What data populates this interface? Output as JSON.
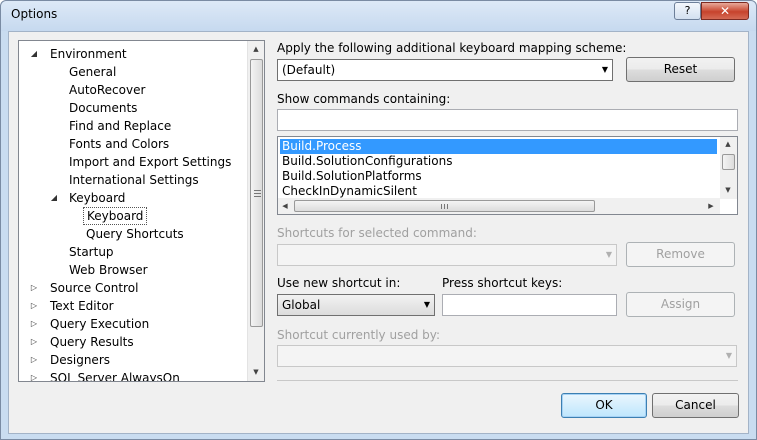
{
  "window": {
    "title": "Options",
    "help_label": "?",
    "close_label": "✕"
  },
  "tree": {
    "items": [
      {
        "label": "Environment",
        "expander": "expanded"
      },
      {
        "label": "General",
        "expander": "none"
      },
      {
        "label": "AutoRecover",
        "expander": "none"
      },
      {
        "label": "Documents",
        "expander": "none"
      },
      {
        "label": "Find and Replace",
        "expander": "none"
      },
      {
        "label": "Fonts and Colors",
        "expander": "none"
      },
      {
        "label": "Import and Export Settings",
        "expander": "none"
      },
      {
        "label": "International Settings",
        "expander": "none"
      },
      {
        "label": "Keyboard",
        "expander": "expanded"
      },
      {
        "label": "Keyboard",
        "expander": "none",
        "selected": true
      },
      {
        "label": "Query Shortcuts",
        "expander": "none"
      },
      {
        "label": "Startup",
        "expander": "none"
      },
      {
        "label": "Web Browser",
        "expander": "none"
      },
      {
        "label": "Source Control",
        "expander": "collapsed"
      },
      {
        "label": "Text Editor",
        "expander": "collapsed"
      },
      {
        "label": "Query Execution",
        "expander": "collapsed"
      },
      {
        "label": "Query Results",
        "expander": "collapsed"
      },
      {
        "label": "Designers",
        "expander": "collapsed"
      },
      {
        "label": "SQL Server AlwaysOn",
        "expander": "collapsed"
      }
    ]
  },
  "mapping": {
    "label": "Apply the following additional keyboard mapping scheme:",
    "value": "(Default)",
    "reset_label": "Reset"
  },
  "commands": {
    "label": "Show commands containing:",
    "search_value": "",
    "items": [
      "Build.Process",
      "Build.SolutionConfigurations",
      "Build.SolutionPlatforms",
      "CheckInDynamicSilent"
    ],
    "selected_index": 0
  },
  "shortcuts": {
    "label": "Shortcuts for selected command:",
    "value": "",
    "remove_label": "Remove"
  },
  "new_shortcut": {
    "use_in_label": "Use new shortcut in:",
    "use_in_value": "Global",
    "press_keys_label": "Press shortcut keys:",
    "press_keys_value": "",
    "assign_label": "Assign"
  },
  "used_by": {
    "label": "Shortcut currently used by:",
    "value": ""
  },
  "footer": {
    "ok_label": "OK",
    "cancel_label": "Cancel"
  }
}
